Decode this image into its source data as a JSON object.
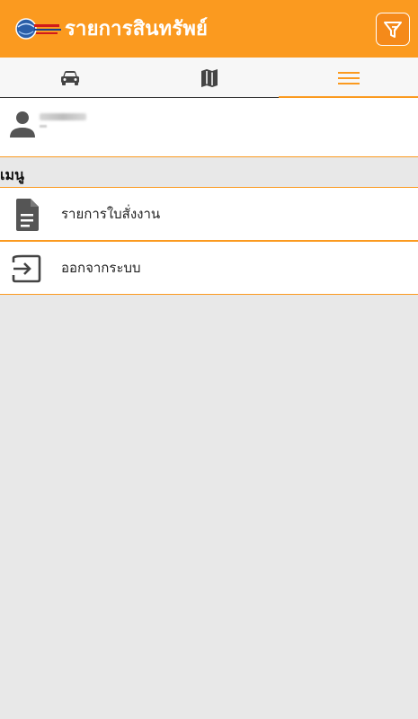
{
  "app": {
    "title": "รายการสินทรัพย์",
    "colors": {
      "accent": "#fb9a1f",
      "background": "#e8e8e8"
    }
  },
  "toolbar": {
    "filter_icon": "filter-icon"
  },
  "tabs": [
    {
      "icon": "car-icon",
      "active": false
    },
    {
      "icon": "map-icon",
      "active": false
    },
    {
      "icon": "menu-icon",
      "active": true
    }
  ],
  "profile": {
    "icon": "person-icon"
  },
  "menu": {
    "section_label": "เมนู",
    "items": [
      {
        "label": "รายการใบสั่งงาน",
        "icon": "document-icon"
      },
      {
        "label": "ออกจากระบบ",
        "icon": "logout-icon"
      }
    ]
  }
}
